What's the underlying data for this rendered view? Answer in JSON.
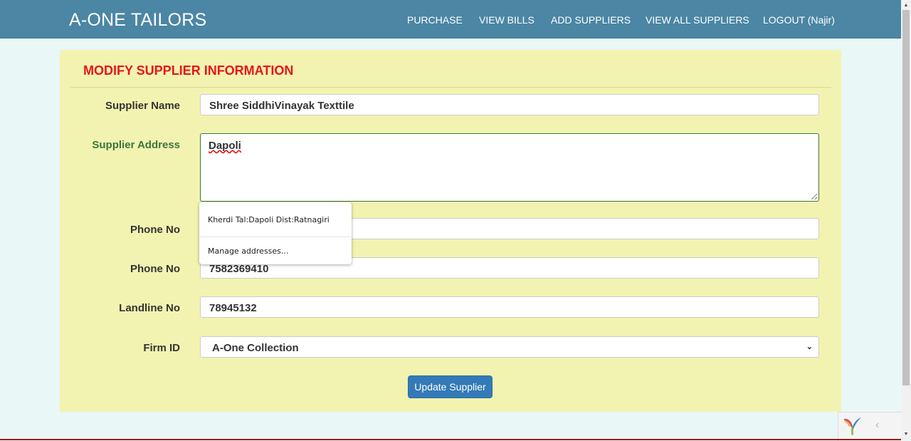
{
  "navbar": {
    "brand": "A-ONE TAILORS",
    "links": [
      "PURCHASE",
      "VIEW BILLS",
      "ADD SUPPLIERS",
      "VIEW ALL SUPPLIERS",
      "LOGOUT (Najir)"
    ],
    "bg_color": "#4b86a4"
  },
  "form": {
    "title": "MODIFY SUPPLIER INFORMATION",
    "title_color": "#e8161b",
    "panel_color": "#f2f3b0",
    "supplier_name": {
      "label": "Supplier Name",
      "value": "Shree SiddhiVinayak Texttile"
    },
    "supplier_address": {
      "label": "Supplier Address",
      "value": "Dapoli"
    },
    "phone_1": {
      "label": "Phone No",
      "value": ""
    },
    "phone_2": {
      "label": "Phone No",
      "value": "7582369410"
    },
    "landline": {
      "label": "Landline No",
      "value": "78945132"
    },
    "firm_id": {
      "label": "Firm ID",
      "selected": "A-One Collection"
    },
    "submit_label": "Update Supplier"
  },
  "autofill": {
    "suggestion": "Kherdi Tal:Dapoli Dist:Ratnagiri",
    "manage": "Manage addresses..."
  },
  "icons": {
    "corner_logo": "yii-logo-icon",
    "corner_chevron": "chevron-left-icon"
  }
}
